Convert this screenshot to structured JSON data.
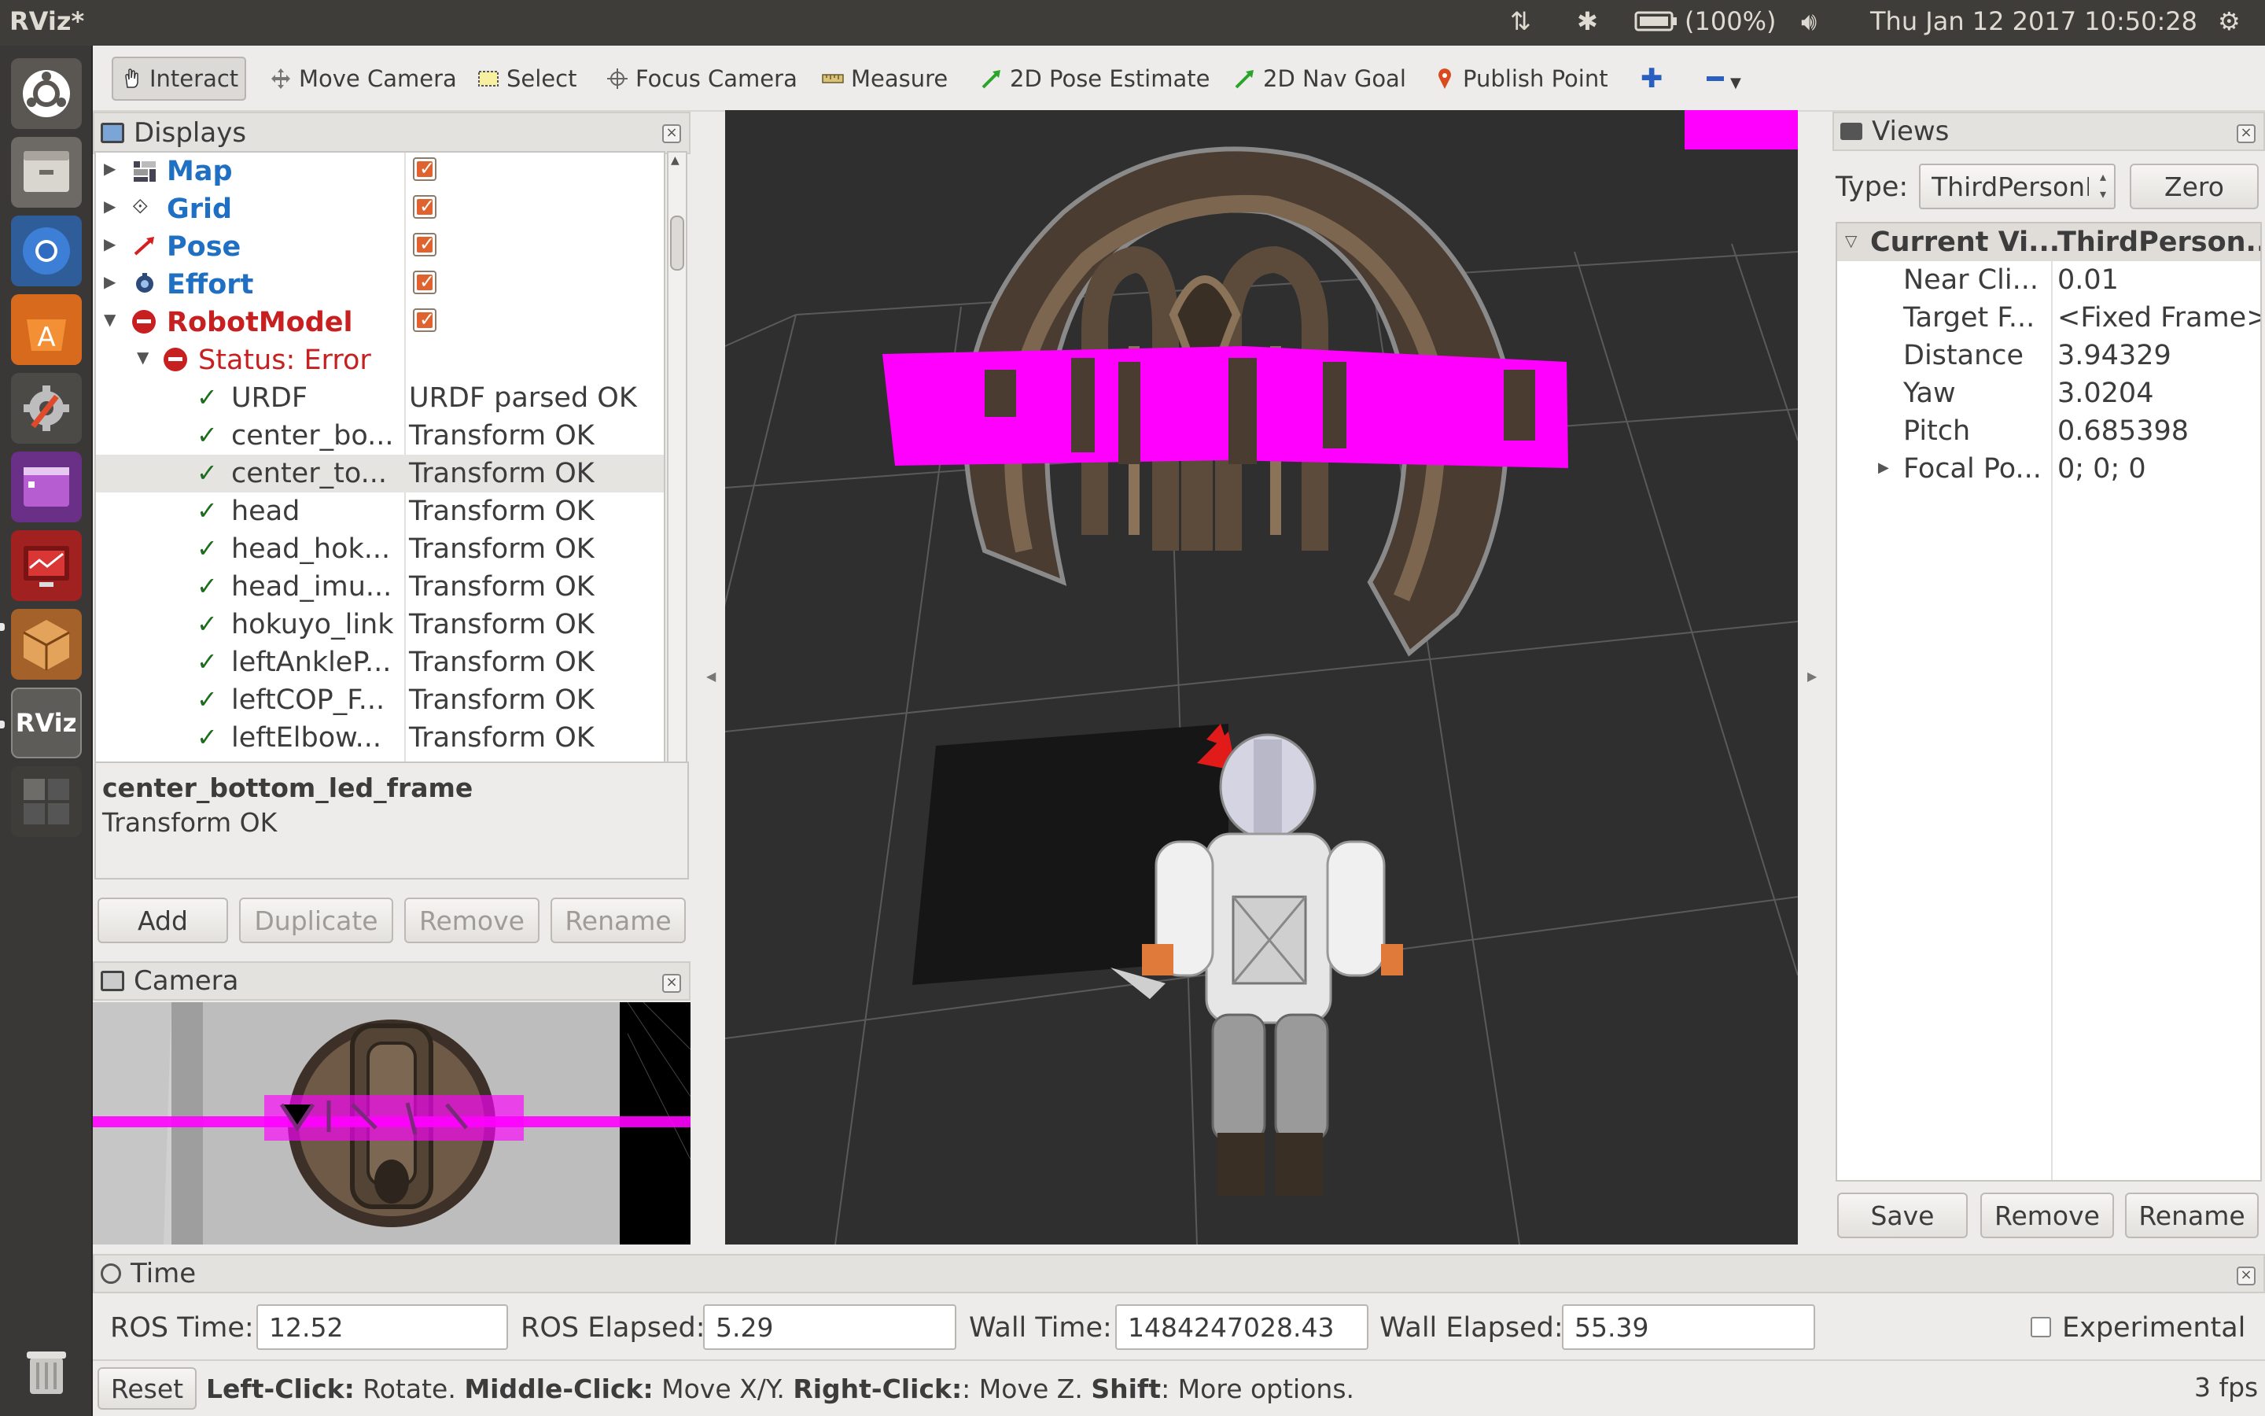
{
  "topbar": {
    "app_title": "RViz*",
    "battery": "(100%)",
    "datetime": "Thu Jan 12 2017 10:50:28"
  },
  "launcher": {
    "items": [
      "ubuntu-dash-icon",
      "files-icon",
      "chromium-icon",
      "software-center-icon",
      "system-settings-icon",
      "workspace-icon",
      "monitor-icon",
      "package-icon",
      "rviz-icon",
      "workspace-switcher-icon"
    ],
    "trash": "trash-icon"
  },
  "toolbar": {
    "interact": "Interact",
    "move_camera": "Move Camera",
    "select": "Select",
    "focus_camera": "Focus Camera",
    "measure": "Measure",
    "pose_estimate": "2D Pose Estimate",
    "nav_goal": "2D Nav Goal",
    "publish_point": "Publish Point"
  },
  "displays": {
    "title": "Displays",
    "items": [
      {
        "label": "Map",
        "color": "#1f6fc2"
      },
      {
        "label": "Grid",
        "color": "#1f6fc2"
      },
      {
        "label": "Pose",
        "color": "#1f6fc2"
      },
      {
        "label": "Effort",
        "color": "#1f6fc2"
      },
      {
        "label": "RobotModel",
        "color": "#c62020"
      }
    ],
    "status_label": "Status: Error",
    "status_rows": [
      {
        "name": "URDF",
        "value": "URDF parsed OK"
      },
      {
        "name": "center_bo...",
        "value": "Transform OK"
      },
      {
        "name": "center_to...",
        "value": "Transform OK"
      },
      {
        "name": "head",
        "value": "Transform OK"
      },
      {
        "name": "head_hok...",
        "value": "Transform OK"
      },
      {
        "name": "head_imu...",
        "value": "Transform OK"
      },
      {
        "name": "hokuyo_link",
        "value": "Transform OK"
      },
      {
        "name": "leftAnkleP...",
        "value": "Transform OK"
      },
      {
        "name": "leftCOP_F...",
        "value": "Transform OK"
      },
      {
        "name": "leftElbow...",
        "value": "Transform OK"
      }
    ],
    "description_title": "center_bottom_led_frame",
    "description_body": "Transform OK",
    "buttons": {
      "add": "Add",
      "duplicate": "Duplicate",
      "remove": "Remove",
      "rename": "Rename"
    }
  },
  "camera": {
    "title": "Camera"
  },
  "views": {
    "title": "Views",
    "type_label": "Type:",
    "type_value": "ThirdPersonI",
    "zero": "Zero",
    "current_name": "Current Vi...",
    "current_value": "ThirdPerson...",
    "props": [
      {
        "name": "Near Cli...",
        "value": "0.01"
      },
      {
        "name": "Target F...",
        "value": "<Fixed Frame>"
      },
      {
        "name": "Distance",
        "value": "3.94329"
      },
      {
        "name": "Yaw",
        "value": "3.0204"
      },
      {
        "name": "Pitch",
        "value": "0.685398"
      },
      {
        "name": "Focal Po...",
        "value": "0; 0; 0"
      }
    ],
    "buttons": {
      "save": "Save",
      "remove": "Remove",
      "rename": "Rename"
    }
  },
  "time": {
    "title": "Time",
    "ros_time_label": "ROS Time:",
    "ros_time": "12.52",
    "ros_elapsed_label": "ROS Elapsed:",
    "ros_elapsed": "5.29",
    "wall_time_label": "Wall Time:",
    "wall_time": "1484247028.43",
    "wall_elapsed_label": "Wall Elapsed:",
    "wall_elapsed": "55.39",
    "experimental": "Experimental"
  },
  "statusbar": {
    "reset": "Reset",
    "h1": "Left-Click:",
    "t1": " Rotate. ",
    "h2": "Middle-Click:",
    "t2": " Move X/Y. ",
    "h3": "Right-Click:",
    "t3": ": Move Z. ",
    "h4": "Shift",
    "t4": ": More options.",
    "fps": "3 fps"
  },
  "colors": {
    "accent_magenta": "#ff00ff",
    "error_red": "#c62020",
    "link_blue": "#1f6fc2",
    "checkbox_orange": "#e0632f"
  }
}
